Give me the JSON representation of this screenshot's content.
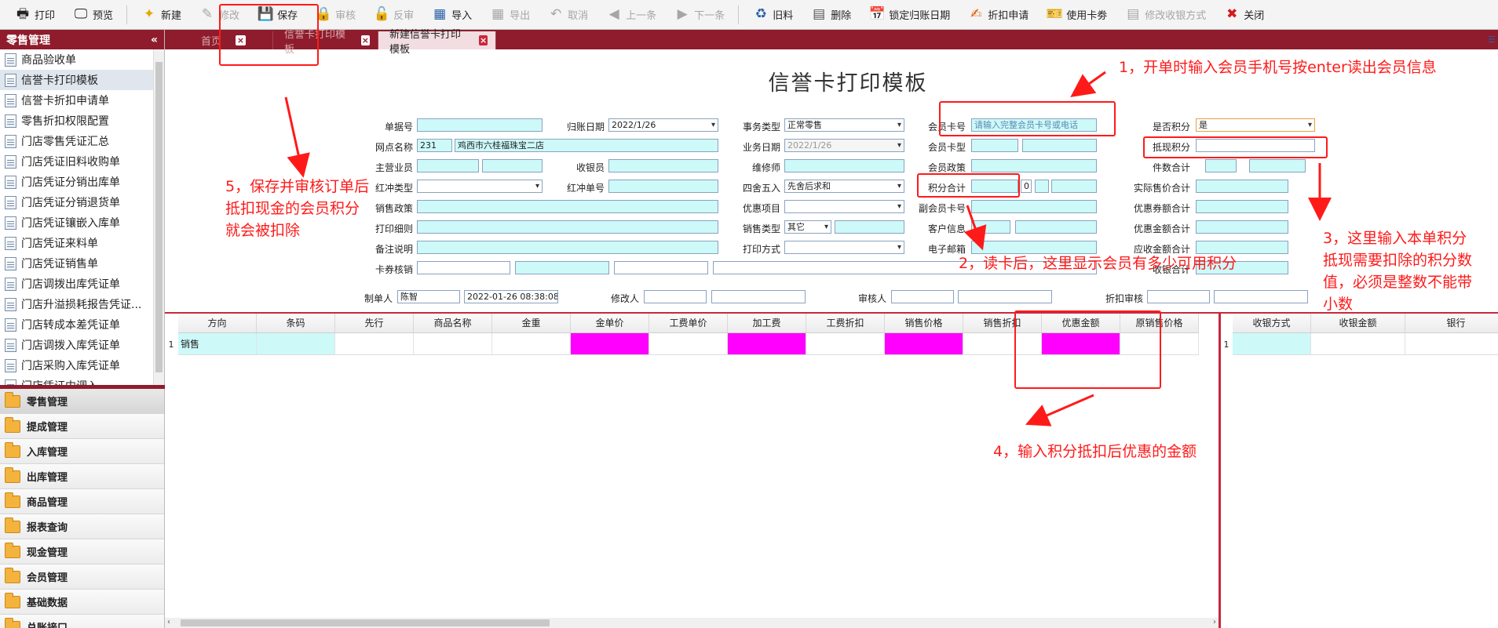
{
  "toolbar": {
    "items": [
      "打印",
      "预览",
      "新建",
      "修改",
      "保存",
      "审核",
      "反审",
      "导入",
      "导出",
      "取消",
      "上一条",
      "下一条",
      "旧料",
      "删除",
      "锁定归账日期",
      "折扣申请",
      "使用卡劵",
      "修改收银方式",
      "关闭"
    ]
  },
  "sidebar": {
    "title": "零售管理",
    "collapse": "«",
    "items": [
      "商品验收单",
      "信誉卡打印模板",
      "信誉卡折扣申请单",
      "零售折扣权限配置",
      "门店零售凭证汇总",
      "门店凭证旧料收购单",
      "门店凭证分销出库单",
      "门店凭证分销退货单",
      "门店凭证镶嵌入库单",
      "门店凭证来料单",
      "门店凭证销售单",
      "门店调拨出库凭证单",
      "门店升溢损耗报告凭证...",
      "门店转成本差凭证单",
      "门店调拨入库凭证单",
      "门店采购入库凭证单",
      "门店凭证内调入..."
    ],
    "folders": [
      "零售管理",
      "提成管理",
      "入库管理",
      "出库管理",
      "商品管理",
      "报表查询",
      "现金管理",
      "会员管理",
      "基础数据",
      "总账接口"
    ]
  },
  "tabs": [
    {
      "label": "首页"
    },
    {
      "label": "信誉卡打印模板"
    },
    {
      "label": "新建信誉卡打印模板"
    }
  ],
  "form": {
    "title": "信誉卡打印模板",
    "labels": {
      "danjuhao": "单据号",
      "guizhang_date": "归账日期",
      "shiwu_type": "事务类型",
      "member_card": "会员卡号",
      "is_points": "是否积分",
      "wangdian": "网点名称",
      "yewu_date": "业务日期",
      "member_card_type": "会员卡型",
      "dixian_points": "抵现积分",
      "yingyeyuan": "主营业员",
      "shouyinyuan": "收银员",
      "weixiushi": "维修师",
      "member_policy": "会员政策",
      "jianshu": "件数合计",
      "hongchong_type": "红冲类型",
      "hongchong_no": "红冲单号",
      "sishe": "四舍五入",
      "points_total": "积分合计",
      "actual_price": "实际售价合计",
      "sales_policy": "销售政策",
      "youhui_item": "优惠项目",
      "sub_card": "副会员卡号",
      "coupon_total": "优惠券额合计",
      "print_detail": "打印细则",
      "sales_type": "销售类型",
      "customer_info": "客户信息",
      "youhui_amount": "优惠金额合计",
      "remark": "备注说明",
      "print_mode": "打印方式",
      "email": "电子邮箱",
      "receivable": "应收金额合计",
      "coupon_verify": "卡券核销",
      "received": "收银合计",
      "creator": "制单人",
      "modifier": "修改人",
      "auditor": "审核人",
      "discount_audit": "折扣审核"
    },
    "values": {
      "guizhang_date": "2022/1/26",
      "shiwu_type": "正常零售",
      "member_card_placeholder": "请输入完整会员卡号或电话",
      "is_points": "是",
      "wangdian_code": "231",
      "wangdian_name": "鸡西市六桂福珠宝二店",
      "yewu_date": "2022/1/26",
      "sishe": "先舍后求和",
      "points_total": "0",
      "sales_type": "其它",
      "creator": "陈智",
      "create_time": "2022-01-26 08:38:08"
    }
  },
  "grid": {
    "columns": [
      "方向",
      "条码",
      "先行",
      "商品名称",
      "金重",
      "金单价",
      "工费单价",
      "加工费",
      "工费折扣",
      "销售价格",
      "销售折扣",
      "优惠金额",
      "原销售价格"
    ],
    "rows": [
      {
        "num": "1",
        "direction": "销售"
      }
    ]
  },
  "pay_grid": {
    "columns": [
      "收银方式",
      "收银金额",
      "银行"
    ],
    "rows": [
      {
        "num": "1"
      }
    ]
  },
  "annotations": {
    "n1": "1，开单时输入会员手机号按enter读出会员信息",
    "n2": "2，读卡后，这里显示会员有多少可用积分",
    "n3": "3，这里输入本单积分抵现需要扣除的积分数值，必须是整数不能带小数",
    "n3_lines": [
      "3，这里输入本单积分",
      "抵现需要扣除的积分数",
      "值，必须是整数不能带",
      "小数"
    ],
    "n4": "4，输入积分抵扣后优惠的金额",
    "n5_lines": [
      "5，保存并审核订单后",
      "抵扣现金的会员积分",
      "就会被扣除"
    ]
  },
  "colors": {
    "brand": "#8e1c2c",
    "annotation": "#ff1a1a",
    "cyan": "#cdf9f9",
    "magenta": "#ff00ff"
  }
}
